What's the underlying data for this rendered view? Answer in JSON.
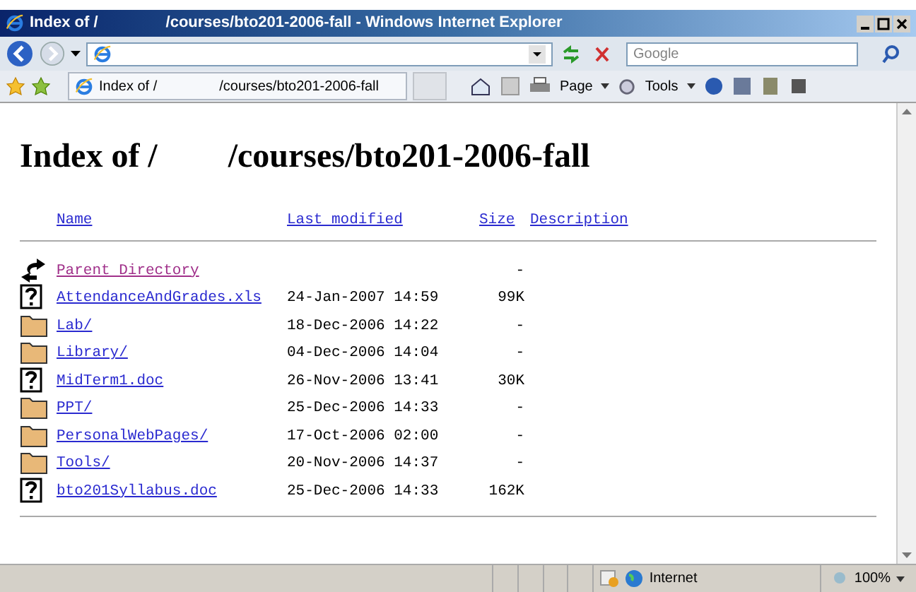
{
  "window": {
    "title": [
      "Index of /",
      "/courses/bto201-2006-fall - Windows Internet Explorer"
    ]
  },
  "search": {
    "placeholder": "Google"
  },
  "tab": {
    "title": [
      "Index of /",
      "/courses/bto201-2006-fall"
    ]
  },
  "command_bar": [
    "Page",
    "Tools"
  ],
  "heading": [
    "Index of /",
    "/courses/bto201-2006-fall"
  ],
  "table": {
    "columns": [
      "Name",
      "Last modified",
      "Size",
      "Description"
    ],
    "rows": [
      {
        "kind": "back",
        "name": "Parent Directory",
        "visited": true,
        "modified": "",
        "size": "-"
      },
      {
        "kind": "unknown",
        "name": "AttendanceAndGrades.xls",
        "visited": false,
        "modified": "24-Jan-2007 14:59",
        "size": "99K"
      },
      {
        "kind": "folder",
        "name": "Lab/",
        "visited": false,
        "modified": "18-Dec-2006 14:22",
        "size": "-"
      },
      {
        "kind": "folder",
        "name": "Library/",
        "visited": false,
        "modified": "04-Dec-2006 14:04",
        "size": "-"
      },
      {
        "kind": "unknown",
        "name": "MidTerm1.doc",
        "visited": false,
        "modified": "26-Nov-2006 13:41",
        "size": "30K"
      },
      {
        "kind": "folder",
        "name": "PPT/",
        "visited": false,
        "modified": "25-Dec-2006 14:33",
        "size": "-"
      },
      {
        "kind": "folder",
        "name": "PersonalWebPages/",
        "visited": false,
        "modified": "17-Oct-2006 02:00",
        "size": "-"
      },
      {
        "kind": "folder",
        "name": "Tools/",
        "visited": false,
        "modified": "20-Nov-2006 14:37",
        "size": "-"
      },
      {
        "kind": "unknown",
        "name": "bto201Syllabus.doc",
        "visited": false,
        "modified": "25-Dec-2006 14:33",
        "size": "162K"
      }
    ]
  },
  "status_bar": {
    "zone": "Internet",
    "zoom": "100%"
  }
}
